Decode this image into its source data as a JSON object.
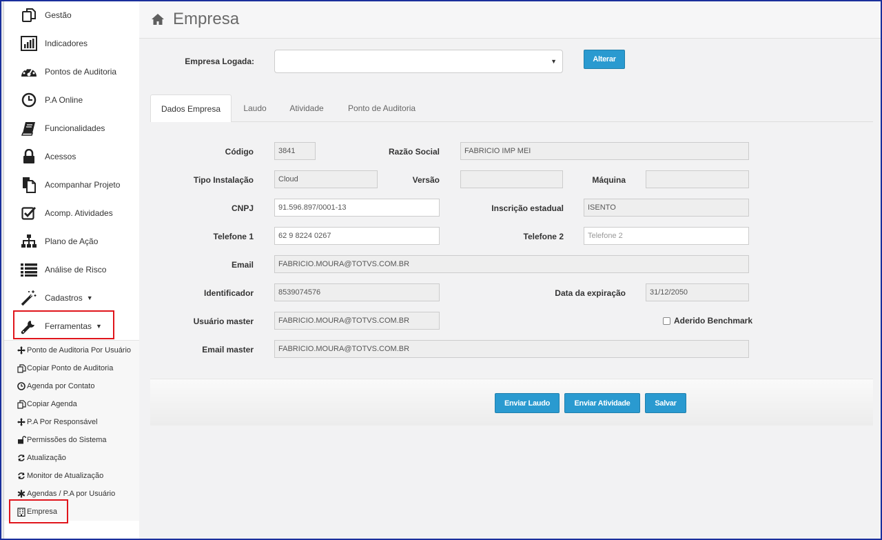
{
  "sidebar": {
    "items": [
      {
        "label": "Gestão",
        "icon": "copy-icon"
      },
      {
        "label": "Indicadores",
        "icon": "bar-chart-icon"
      },
      {
        "label": "Pontos de Auditoria",
        "icon": "dashboard-icon"
      },
      {
        "label": "P.A Online",
        "icon": "clock-icon"
      },
      {
        "label": "Funcionalidades",
        "icon": "book-icon"
      },
      {
        "label": "Acessos",
        "icon": "lock-icon"
      },
      {
        "label": "Acompanhar Projeto",
        "icon": "file-icon"
      },
      {
        "label": "Acomp. Atividades",
        "icon": "check-square-icon"
      },
      {
        "label": "Plano de Ação",
        "icon": "sitemap-icon"
      },
      {
        "label": "Análise de Risco",
        "icon": "list-icon"
      },
      {
        "label": "Cadastros",
        "icon": "magic-wand-icon"
      },
      {
        "label": "Ferramentas",
        "icon": "wrench-icon"
      }
    ],
    "submenu": [
      {
        "label": "Ponto de Auditoria Por Usuário",
        "icon": "move-icon"
      },
      {
        "label": "Copiar Ponto de Auditoria",
        "icon": "copy-icon"
      },
      {
        "label": "Agenda por Contato",
        "icon": "clock-icon"
      },
      {
        "label": "Copiar Agenda",
        "icon": "copy-icon"
      },
      {
        "label": "P.A Por Responsável",
        "icon": "move-icon"
      },
      {
        "label": "Permissões do Sistema",
        "icon": "unlock-icon"
      },
      {
        "label": "Atualização",
        "icon": "refresh-icon"
      },
      {
        "label": "Monitor de Atualização",
        "icon": "refresh-icon"
      },
      {
        "label": "Agendas / P.A por Usuário",
        "icon": "asterisk-icon"
      },
      {
        "label": "Empresa",
        "icon": "building-icon"
      }
    ]
  },
  "header": {
    "title": "Empresa",
    "icon": "home-icon"
  },
  "company_select": {
    "label": "Empresa Logada:",
    "value": "",
    "button": "Alterar"
  },
  "tabs": [
    "Dados Empresa",
    "Laudo",
    "Atividade",
    "Ponto de Auditoria"
  ],
  "form": {
    "codigo": {
      "label": "Código",
      "value": "3841"
    },
    "razao_social": {
      "label": "Razão Social",
      "value": "FABRICIO IMP MEI"
    },
    "tipo_instalacao": {
      "label": "Tipo Instalação",
      "value": "Cloud"
    },
    "versao": {
      "label": "Versão",
      "value": ""
    },
    "maquina": {
      "label": "Máquina",
      "value": ""
    },
    "cnpj": {
      "label": "CNPJ",
      "value": "91.596.897/0001-13"
    },
    "inscricao_estadual": {
      "label": "Inscrição estadual",
      "value": "ISENTO"
    },
    "telefone1": {
      "label": "Telefone 1",
      "value": "62 9 8224 0267"
    },
    "telefone2": {
      "label": "Telefone 2",
      "placeholder": "Telefone 2"
    },
    "email": {
      "label": "Email",
      "value": "FABRICIO.MOURA@TOTVS.COM.BR"
    },
    "identificador": {
      "label": "Identificador",
      "value": "8539074576"
    },
    "data_expiracao": {
      "label": "Data da expiração",
      "value": "31/12/2050"
    },
    "usuario_master": {
      "label": "Usuário master",
      "value": "FABRICIO.MOURA@TOTVS.COM.BR"
    },
    "aderido_benchmark": {
      "label": "Aderido Benchmark",
      "checked": false
    },
    "email_master": {
      "label": "Email master",
      "value": "FABRICIO.MOURA@TOTVS.COM.BR"
    }
  },
  "footer": {
    "enviar_laudo": "Enviar Laudo",
    "enviar_atividade": "Enviar Atividade",
    "salvar": "Salvar"
  },
  "colors": {
    "accent": "#2a9ad0",
    "highlight": "#e0141b",
    "frame": "#1a2f9c"
  }
}
